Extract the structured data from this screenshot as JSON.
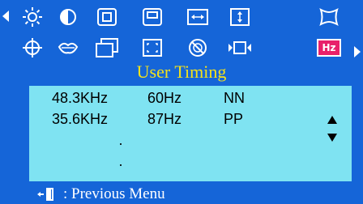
{
  "menu": {
    "title": "User Timing",
    "colors": {
      "background": "#1565d8",
      "panel": "#7fe3f2",
      "title": "#f5e21a",
      "selected": "#e8206a"
    },
    "icons_row1": [
      "brightness-icon",
      "contrast-icon",
      "h-position-icon",
      "v-position-icon",
      "h-size-icon",
      "v-size-icon",
      "pincushion-icon"
    ],
    "icons_row2": [
      "color-icon",
      "recall-icon",
      "language-icon",
      "zoom-icon",
      "degauss-icon",
      "input-icon",
      "hz-icon"
    ],
    "selected_icon": "hz-icon",
    "hz_label": "Hz"
  },
  "timing_table": {
    "rows": [
      {
        "h_freq": "48.3KHz",
        "v_freq": "60Hz",
        "polarity": "NN"
      },
      {
        "h_freq": "35.6KHz",
        "v_freq": "87Hz",
        "polarity": "PP"
      }
    ],
    "ellipsis": [
      "·",
      "·"
    ]
  },
  "footer": {
    "label": ": Previous Menu"
  }
}
